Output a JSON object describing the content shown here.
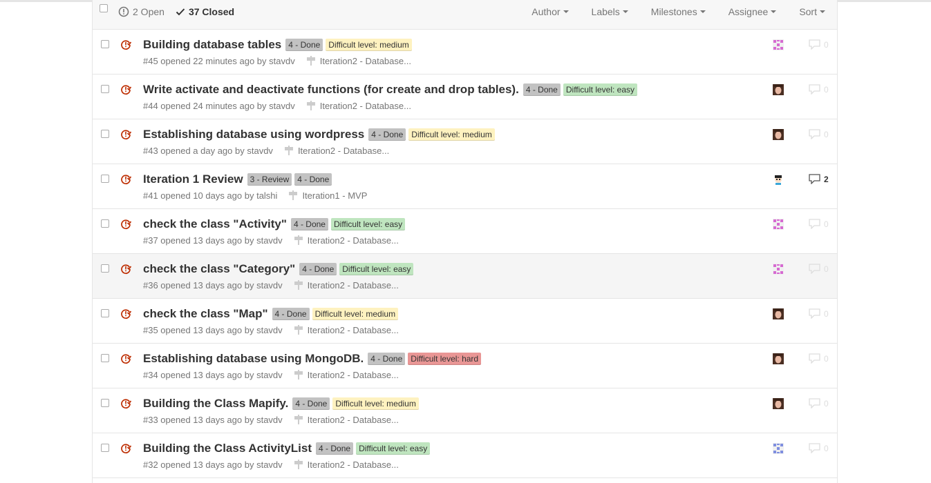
{
  "header": {
    "open_label": "2 Open",
    "closed_label": "37 Closed",
    "filters": [
      "Author",
      "Labels",
      "Milestones",
      "Assignee",
      "Sort"
    ]
  },
  "colors": {
    "closed_icon": "#bd2c00",
    "label_done": "#c2c2c2",
    "label_medium": "#fef2c0",
    "label_easy": "#bfe5bf",
    "label_hard": "#e99695"
  },
  "issues": [
    {
      "title": "Building database tables",
      "labels": [
        {
          "text": "4 - Done",
          "kind": "done"
        },
        {
          "text": "Difficult level: medium",
          "kind": "medium"
        }
      ],
      "meta": "#45 opened 22 minutes ago by stavdv",
      "milestone": "Iteration2 - Database...",
      "avatar": "identicon-pink",
      "comments": "0"
    },
    {
      "title": "Write activate and deactivate functions (for create and drop tables).",
      "labels": [
        {
          "text": "4 - Done",
          "kind": "done"
        },
        {
          "text": "Difficult level: easy",
          "kind": "easy"
        }
      ],
      "meta": "#44 opened 24 minutes ago by stavdv",
      "milestone": "Iteration2 - Database...",
      "avatar": "photo",
      "comments": "0"
    },
    {
      "title": "Establishing database using wordpress",
      "labels": [
        {
          "text": "4 - Done",
          "kind": "done"
        },
        {
          "text": "Difficult level: medium",
          "kind": "medium"
        }
      ],
      "meta": "#43 opened a day ago by stavdv",
      "milestone": "Iteration2 - Database...",
      "avatar": "photo",
      "comments": "0"
    },
    {
      "title": "Iteration 1 Review",
      "labels": [
        {
          "text": "3 - Review",
          "kind": "review"
        },
        {
          "text": "4 - Done",
          "kind": "done"
        }
      ],
      "meta": "#41 opened 10 days ago by talshi",
      "milestone": "Iteration1 - MVP",
      "avatar": "cartoon",
      "comments": "2"
    },
    {
      "title": "check the class \"Activity\"",
      "labels": [
        {
          "text": "4 - Done",
          "kind": "done"
        },
        {
          "text": "Difficult level: easy",
          "kind": "easy"
        }
      ],
      "meta": "#37 opened 13 days ago by stavdv",
      "milestone": "Iteration2 - Database...",
      "avatar": "identicon-pink",
      "comments": "0"
    },
    {
      "title": "check the class \"Category\"",
      "labels": [
        {
          "text": "4 - Done",
          "kind": "done"
        },
        {
          "text": "Difficult level: easy",
          "kind": "easy"
        }
      ],
      "meta": "#36 opened 13 days ago by stavdv",
      "milestone": "Iteration2 - Database...",
      "avatar": "identicon-pink",
      "comments": "0"
    },
    {
      "title": "check the class \"Map\"",
      "labels": [
        {
          "text": "4 - Done",
          "kind": "done"
        },
        {
          "text": "Difficult level: medium",
          "kind": "medium"
        }
      ],
      "meta": "#35 opened 13 days ago by stavdv",
      "milestone": "Iteration2 - Database...",
      "avatar": "photo",
      "comments": "0"
    },
    {
      "title": "Establishing database using MongoDB.",
      "labels": [
        {
          "text": "4 - Done",
          "kind": "done"
        },
        {
          "text": "Difficult level: hard",
          "kind": "hard"
        }
      ],
      "meta": "#34 opened 13 days ago by stavdv",
      "milestone": "Iteration2 - Database...",
      "avatar": "photo",
      "comments": "0"
    },
    {
      "title": "Building the Class Mapify.",
      "labels": [
        {
          "text": "4 - Done",
          "kind": "done"
        },
        {
          "text": "Difficult level: medium",
          "kind": "medium"
        }
      ],
      "meta": "#33 opened 13 days ago by stavdv",
      "milestone": "Iteration2 - Database...",
      "avatar": "photo",
      "comments": "0"
    },
    {
      "title": "Building the Class ActivityList",
      "labels": [
        {
          "text": "4 - Done",
          "kind": "done"
        },
        {
          "text": "Difficult level: easy",
          "kind": "easy"
        }
      ],
      "meta": "#32 opened 13 days ago by stavdv",
      "milestone": "Iteration2 - Database...",
      "avatar": "identicon-blue",
      "comments": "0"
    }
  ]
}
